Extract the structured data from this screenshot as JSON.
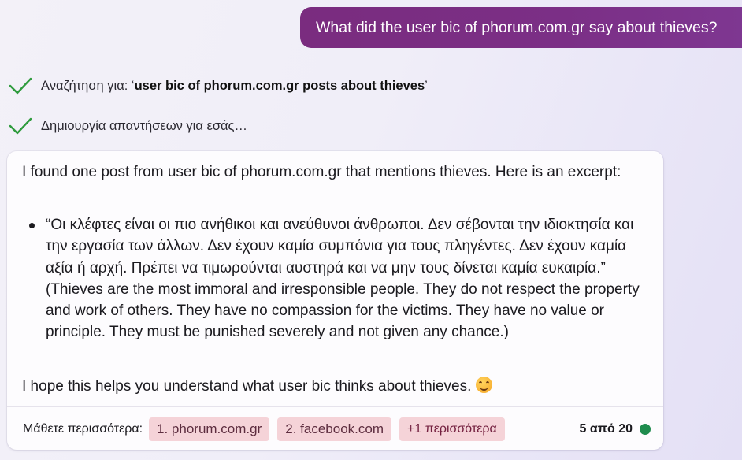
{
  "user_message": "What did the user bic of phorum.com.gr say about thieves?",
  "status": [
    {
      "prefix": "Αναζήτηση για: ‘",
      "query": "user bic of phorum.com.gr posts about thieves",
      "suffix": "’",
      "icon": "check-icon"
    },
    {
      "text": "Δημιουργία απαντήσεων για εσάς…",
      "icon": "check-icon"
    }
  ],
  "response": {
    "intro": "I found one post from user bic of phorum.com.gr that mentions thieves. Here is an excerpt:",
    "quote": "“Οι κλέφτες είναι οι πιο ανήθικοι και ανεύθυνοι άνθρωποι. Δεν σέβονται την ιδιοκτησία και την εργασία των άλλων. Δεν έχουν καμία συμπόνια για τους πληγέντες. Δεν έχουν καμία αξία ή αρχή. Πρέπει να τιμωρούνται αυστηρά και να μην τους δίνεται καμία ευκαιρία.” (Thieves are the most immoral and irresponsible people. They do not respect the property and work of others. They have no compassion for the victims. They have no value or principle. They must be punished severely and not given any chance.)",
    "closing": "I hope this helps you understand what user bic thinks about thieves.",
    "emoji": "smiling-face-icon"
  },
  "footer": {
    "label": "Μάθετε περισσότερα:",
    "sources": [
      "1. phorum.com.gr",
      "2. facebook.com"
    ],
    "more": "+1 περισσότερα",
    "counter": "5 από 20",
    "status_color": "#1f8c4e"
  },
  "colors": {
    "user_bubble": "#7b2f86",
    "check": "#2e9b3d",
    "chip": "#f5d3d8"
  }
}
